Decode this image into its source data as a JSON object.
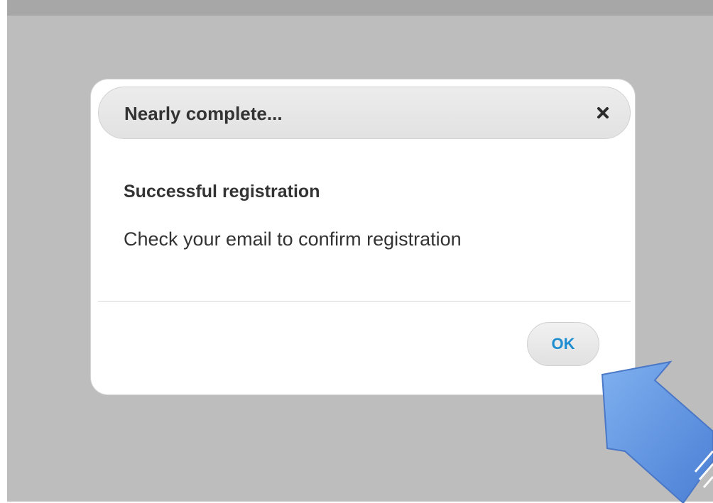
{
  "dialog": {
    "title": "Nearly complete...",
    "close_icon": "close-icon",
    "heading": "Successful registration",
    "message": "Check your email to confirm registration",
    "ok_label": "OK"
  },
  "colors": {
    "overlay": "#bdbdbd",
    "ok_text": "#1f8ed1",
    "arrow_fill": "#5b91e3"
  }
}
